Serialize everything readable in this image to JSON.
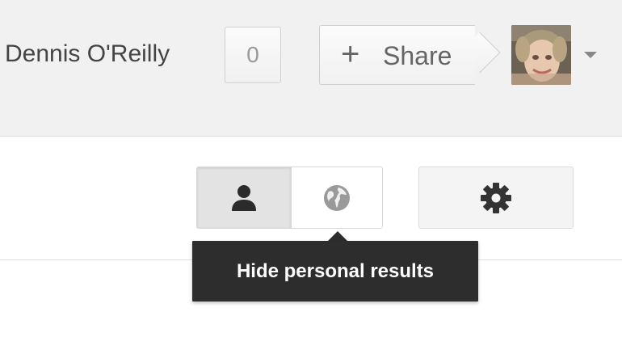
{
  "header": {
    "user_name": "Dennis O'Reilly",
    "notification_count": "0",
    "share_button": {
      "icon": "plus-icon",
      "label": "Share"
    },
    "avatar": {
      "icon": "avatar-photo",
      "dropdown_icon": "caret-down-icon"
    }
  },
  "toolbar": {
    "personal_results_icon": "person-icon",
    "global_results_icon": "globe-icon",
    "settings_icon": "gear-icon"
  },
  "tooltip": {
    "text": "Hide personal results"
  },
  "colors": {
    "header_bg": "#f1f1f1",
    "tooltip_bg": "#2d2d2d",
    "icon_dark": "#333333",
    "icon_gray": "#999999"
  }
}
